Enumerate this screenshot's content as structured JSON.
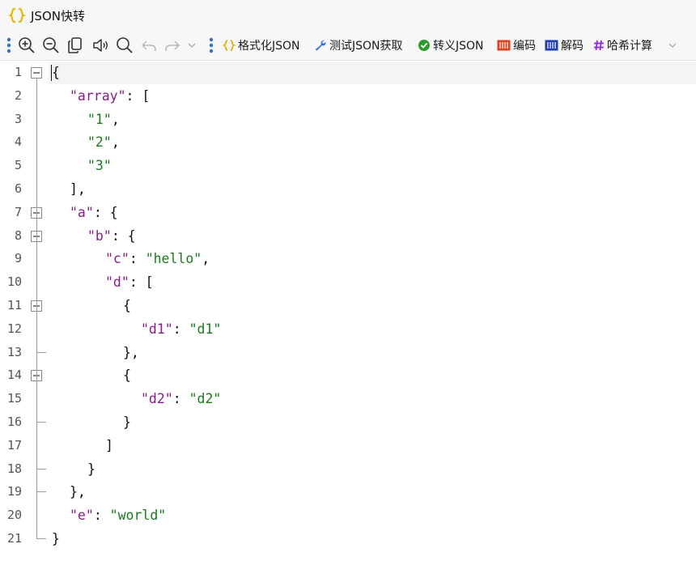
{
  "app": {
    "title": "JSON快转"
  },
  "toolbar": {
    "format_label": "格式化JSON",
    "test_label": "测试JSON获取",
    "escape_label": "转义JSON",
    "encode_label": "编码",
    "decode_label": "解码",
    "hash_label": "哈希计算"
  },
  "editor": {
    "lines": [
      {
        "n": "1",
        "tokens": [
          [
            "p",
            "{"
          ]
        ]
      },
      {
        "n": "2",
        "tokens": [
          [
            "k",
            "\"array\""
          ],
          [
            "p",
            ": ["
          ]
        ]
      },
      {
        "n": "3",
        "tokens": [
          [
            "s",
            "\"1\""
          ],
          [
            "p",
            ","
          ]
        ]
      },
      {
        "n": "4",
        "tokens": [
          [
            "s",
            "\"2\""
          ],
          [
            "p",
            ","
          ]
        ]
      },
      {
        "n": "5",
        "tokens": [
          [
            "s",
            "\"3\""
          ]
        ]
      },
      {
        "n": "6",
        "tokens": [
          [
            "p",
            "],"
          ]
        ]
      },
      {
        "n": "7",
        "tokens": [
          [
            "k",
            "\"a\""
          ],
          [
            "p",
            ": {"
          ]
        ]
      },
      {
        "n": "8",
        "tokens": [
          [
            "k",
            "\"b\""
          ],
          [
            "p",
            ": {"
          ]
        ]
      },
      {
        "n": "9",
        "tokens": [
          [
            "k",
            "\"c\""
          ],
          [
            "p",
            ": "
          ],
          [
            "s",
            "\"hello\""
          ],
          [
            "p",
            ","
          ]
        ]
      },
      {
        "n": "10",
        "tokens": [
          [
            "k",
            "\"d\""
          ],
          [
            "p",
            ": ["
          ]
        ]
      },
      {
        "n": "11",
        "tokens": [
          [
            "p",
            "{"
          ]
        ]
      },
      {
        "n": "12",
        "tokens": [
          [
            "k",
            "\"d1\""
          ],
          [
            "p",
            ": "
          ],
          [
            "s",
            "\"d1\""
          ]
        ]
      },
      {
        "n": "13",
        "tokens": [
          [
            "p",
            "},"
          ]
        ]
      },
      {
        "n": "14",
        "tokens": [
          [
            "p",
            "{"
          ]
        ]
      },
      {
        "n": "15",
        "tokens": [
          [
            "k",
            "\"d2\""
          ],
          [
            "p",
            ": "
          ],
          [
            "s",
            "\"d2\""
          ]
        ]
      },
      {
        "n": "16",
        "tokens": [
          [
            "p",
            "}"
          ]
        ]
      },
      {
        "n": "17",
        "tokens": [
          [
            "p",
            "]"
          ]
        ]
      },
      {
        "n": "18",
        "tokens": [
          [
            "p",
            "}"
          ]
        ]
      },
      {
        "n": "19",
        "tokens": [
          [
            "p",
            "},"
          ]
        ]
      },
      {
        "n": "20",
        "tokens": [
          [
            "k",
            "\"e\""
          ],
          [
            "p",
            ": "
          ],
          [
            "s",
            "\"world\""
          ]
        ]
      },
      {
        "n": "21",
        "tokens": [
          [
            "p",
            "}"
          ]
        ]
      }
    ]
  },
  "colors": {
    "key": "#8b1a8b",
    "string": "#1a7a1a",
    "accent_blue": "#2f6fd6",
    "encode_red": "#d9441c",
    "hash_purple": "#8a2be2",
    "check_green": "#2e9b2e"
  }
}
